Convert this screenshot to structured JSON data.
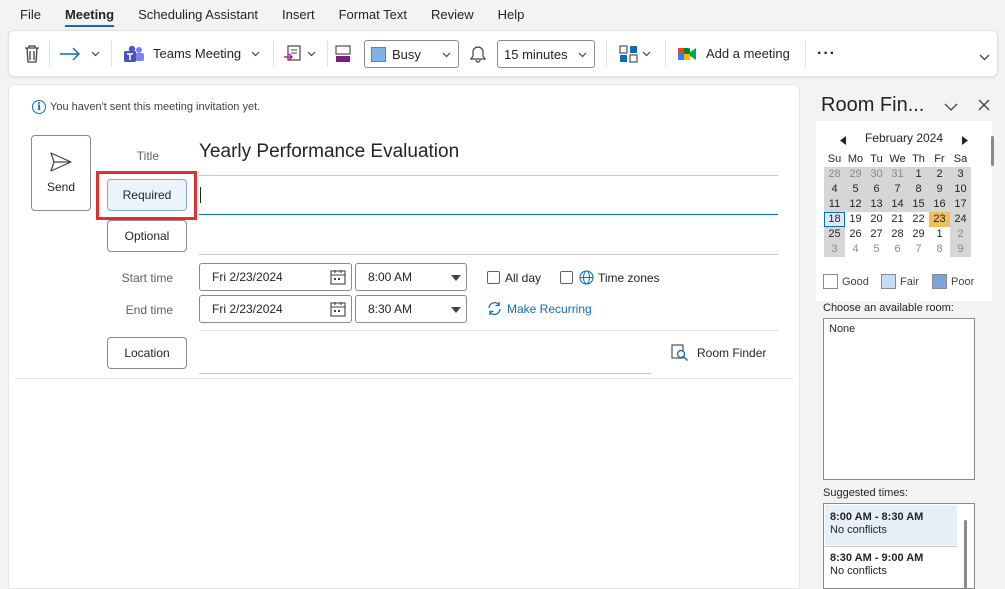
{
  "menu": {
    "items": [
      "File",
      "Meeting",
      "Scheduling Assistant",
      "Insert",
      "Format Text",
      "Review",
      "Help"
    ],
    "active_index": 1
  },
  "ribbon": {
    "teams_label": "Teams Meeting",
    "show_as_value": "Busy",
    "reminder_value": "15 minutes",
    "add_meeting_label": "Add a meeting",
    "more_label": "···"
  },
  "compose": {
    "info_text": "You haven't sent this meeting invitation yet.",
    "send_label": "Send",
    "title_label": "Title",
    "title_value": "Yearly Performance Evaluation",
    "required_label": "Required",
    "optional_label": "Optional",
    "start_label": "Start time",
    "end_label": "End time",
    "start_date": "Fri 2/23/2024",
    "start_time": "8:00 AM",
    "end_date": "Fri 2/23/2024",
    "end_time": "8:30 AM",
    "all_day_label": "All day",
    "time_zones_label": "Time zones",
    "make_recurring_label": "Make Recurring",
    "location_label": "Location",
    "room_finder_label": "Room Finder"
  },
  "room_finder": {
    "title": "Room Fin...",
    "month": "February 2024",
    "weekdays": [
      "Su",
      "Mo",
      "Tu",
      "We",
      "Th",
      "Fr",
      "Sa"
    ],
    "weeks": [
      [
        "28",
        "29",
        "30",
        "31",
        "1",
        "2",
        "3"
      ],
      [
        "4",
        "5",
        "6",
        "7",
        "8",
        "9",
        "10"
      ],
      [
        "11",
        "12",
        "13",
        "14",
        "15",
        "16",
        "17"
      ],
      [
        "18",
        "19",
        "20",
        "21",
        "22",
        "23",
        "24"
      ],
      [
        "25",
        "26",
        "27",
        "28",
        "29",
        "1",
        "2"
      ],
      [
        "3",
        "4",
        "5",
        "6",
        "7",
        "8",
        "9"
      ]
    ],
    "legend_good": "Good",
    "legend_fair": "Fair",
    "legend_poor": "Poor",
    "choose_room_label": "Choose an available room:",
    "room_none": "None",
    "suggested_label": "Suggested times:",
    "suggestions": [
      {
        "time": "8:00 AM - 8:30 AM",
        "status": "No conflicts"
      },
      {
        "time": "8:30 AM - 9:00 AM",
        "status": "No conflicts"
      }
    ]
  }
}
